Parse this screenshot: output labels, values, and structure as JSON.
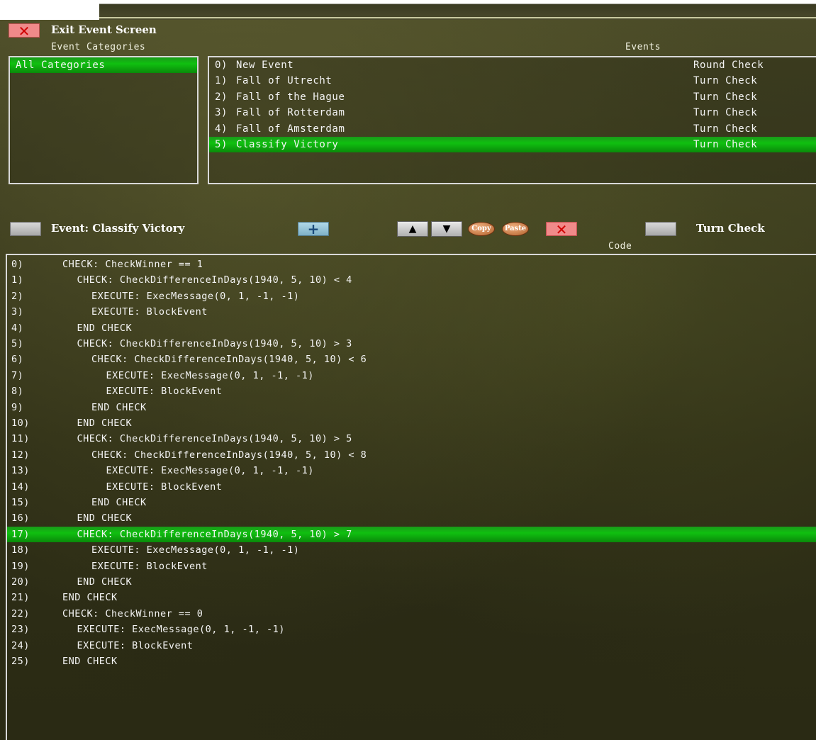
{
  "header": {
    "exit_label": "Exit Event Screen",
    "categories_label": "Event Categories",
    "events_label": "Events"
  },
  "categories": [
    "All Categories"
  ],
  "events": [
    {
      "num": "0)",
      "name": "New Event",
      "type": "Round Check"
    },
    {
      "num": "1)",
      "name": "Fall of Utrecht",
      "type": "Turn Check"
    },
    {
      "num": "2)",
      "name": "Fall of the Hague",
      "type": "Turn Check"
    },
    {
      "num": "3)",
      "name": "Fall of Rotterdam",
      "type": "Turn Check"
    },
    {
      "num": "4)",
      "name": "Fall of Amsterdam",
      "type": "Turn Check"
    },
    {
      "num": "5)",
      "name": "Classify Victory",
      "type": "Turn Check"
    }
  ],
  "selected_event_index": 5,
  "toolbar": {
    "event_label": "Event: Classify Victory",
    "copy_label": "Copy",
    "paste_label": "Paste",
    "check_type_label": "Turn Check",
    "code_label": "Code"
  },
  "code": [
    {
      "num": "0)",
      "text": "CHECK: CheckWinner == 1",
      "indent": 0
    },
    {
      "num": "1)",
      "text": "CHECK: CheckDifferenceInDays(1940, 5, 10) < 4",
      "indent": 1
    },
    {
      "num": "2)",
      "text": "EXECUTE: ExecMessage(0, 1, -1, -1)",
      "indent": 2
    },
    {
      "num": "3)",
      "text": "EXECUTE: BlockEvent",
      "indent": 2
    },
    {
      "num": "4)",
      "text": "END CHECK",
      "indent": 1
    },
    {
      "num": "5)",
      "text": "CHECK: CheckDifferenceInDays(1940, 5, 10) > 3",
      "indent": 1
    },
    {
      "num": "6)",
      "text": "CHECK: CheckDifferenceInDays(1940, 5, 10) < 6",
      "indent": 2
    },
    {
      "num": "7)",
      "text": "EXECUTE: ExecMessage(0, 1, -1, -1)",
      "indent": 3
    },
    {
      "num": "8)",
      "text": "EXECUTE: BlockEvent",
      "indent": 3
    },
    {
      "num": "9)",
      "text": "END CHECK",
      "indent": 2
    },
    {
      "num": "10)",
      "text": "END CHECK",
      "indent": 1
    },
    {
      "num": "11)",
      "text": "CHECK: CheckDifferenceInDays(1940, 5, 10) > 5",
      "indent": 1
    },
    {
      "num": "12)",
      "text": "CHECK: CheckDifferenceInDays(1940, 5, 10) < 8",
      "indent": 2
    },
    {
      "num": "13)",
      "text": "EXECUTE: ExecMessage(0, 1, -1, -1)",
      "indent": 3
    },
    {
      "num": "14)",
      "text": "EXECUTE: BlockEvent",
      "indent": 3
    },
    {
      "num": "15)",
      "text": "END CHECK",
      "indent": 2
    },
    {
      "num": "16)",
      "text": "END CHECK",
      "indent": 1
    },
    {
      "num": "17)",
      "text": "CHECK: CheckDifferenceInDays(1940, 5, 10) > 7",
      "indent": 1
    },
    {
      "num": "18)",
      "text": "EXECUTE: ExecMessage(0, 1, -1, -1)",
      "indent": 2
    },
    {
      "num": "19)",
      "text": "EXECUTE: BlockEvent",
      "indent": 2
    },
    {
      "num": "20)",
      "text": "END CHECK",
      "indent": 1
    },
    {
      "num": "21)",
      "text": "END CHECK",
      "indent": 0
    },
    {
      "num": "22)",
      "text": "CHECK: CheckWinner == 0",
      "indent": 0
    },
    {
      "num": "23)",
      "text": "EXECUTE: ExecMessage(0, 1, -1, -1)",
      "indent": 1
    },
    {
      "num": "24)",
      "text": "EXECUTE: BlockEvent",
      "indent": 1
    },
    {
      "num": "25)",
      "text": "END CHECK",
      "indent": 0
    }
  ],
  "selected_code_index": 17,
  "colors": {
    "selection": "#10c010",
    "close": "#f08a8a",
    "panel_border": "#d8d8d8"
  },
  "icons": [
    "close-icon",
    "plus-icon",
    "arrow-up-icon",
    "arrow-down-icon",
    "copy-icon",
    "paste-icon",
    "delete-icon"
  ]
}
